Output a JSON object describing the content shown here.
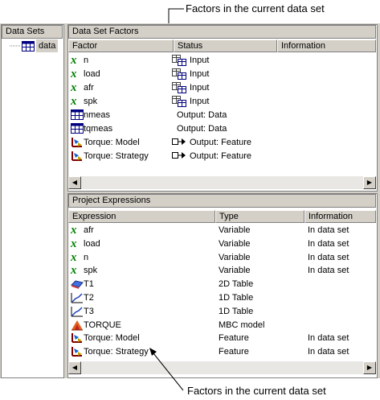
{
  "annotations": {
    "top": "Factors in the current data set",
    "bottom": "Factors in the current data set"
  },
  "datasets": {
    "header": "Data Sets",
    "item": "data"
  },
  "factors": {
    "header": "Data Set Factors",
    "columns": [
      "Factor",
      "Status",
      "Information"
    ],
    "rows": [
      {
        "icon": "x-variable-icon",
        "name": "n",
        "status_icon": "input-icon",
        "status": "Input"
      },
      {
        "icon": "x-variable-icon",
        "name": "load",
        "status_icon": "input-icon",
        "status": "Input"
      },
      {
        "icon": "x-variable-icon",
        "name": "afr",
        "status_icon": "input-icon",
        "status": "Input"
      },
      {
        "icon": "x-variable-icon",
        "name": "spk",
        "status_icon": "input-icon",
        "status": "Input"
      },
      {
        "icon": "table-icon",
        "name": "nmeas",
        "status_icon": "",
        "status": "Output: Data"
      },
      {
        "icon": "table-icon",
        "name": "tqmeas",
        "status_icon": "",
        "status": "Output: Data"
      },
      {
        "icon": "model-icon",
        "name": "Torque: Model",
        "status_icon": "feature-icon",
        "status": "Output: Feature"
      },
      {
        "icon": "model-icon",
        "name": "Torque: Strategy",
        "status_icon": "feature-icon",
        "status": "Output: Feature"
      }
    ]
  },
  "expressions": {
    "header": "Project Expressions",
    "columns": [
      "Expression",
      "Type",
      "Information"
    ],
    "rows": [
      {
        "icon": "x-variable-icon",
        "name": "afr",
        "type": "Variable",
        "info": "In data set"
      },
      {
        "icon": "x-variable-icon",
        "name": "load",
        "type": "Variable",
        "info": "In data set"
      },
      {
        "icon": "x-variable-icon",
        "name": "n",
        "type": "Variable",
        "info": "In data set"
      },
      {
        "icon": "x-variable-icon",
        "name": "spk",
        "type": "Variable",
        "info": "In data set"
      },
      {
        "icon": "2d-table-icon",
        "name": "T1",
        "type": "2D Table",
        "info": ""
      },
      {
        "icon": "1d-table-icon",
        "name": "T2",
        "type": "1D Table",
        "info": ""
      },
      {
        "icon": "1d-table-icon",
        "name": "T3",
        "type": "1D Table",
        "info": ""
      },
      {
        "icon": "mbc-model-icon",
        "name": "TORQUE",
        "type": "MBC model",
        "info": ""
      },
      {
        "icon": "model-icon",
        "name": "Torque: Model",
        "type": "Feature",
        "info": "In data set"
      },
      {
        "icon": "model-icon",
        "name": "Torque: Strategy",
        "type": "Feature",
        "info": "In data set"
      }
    ]
  },
  "colors": {
    "panel": "#d4d0c8",
    "variable_green": "#008000"
  }
}
